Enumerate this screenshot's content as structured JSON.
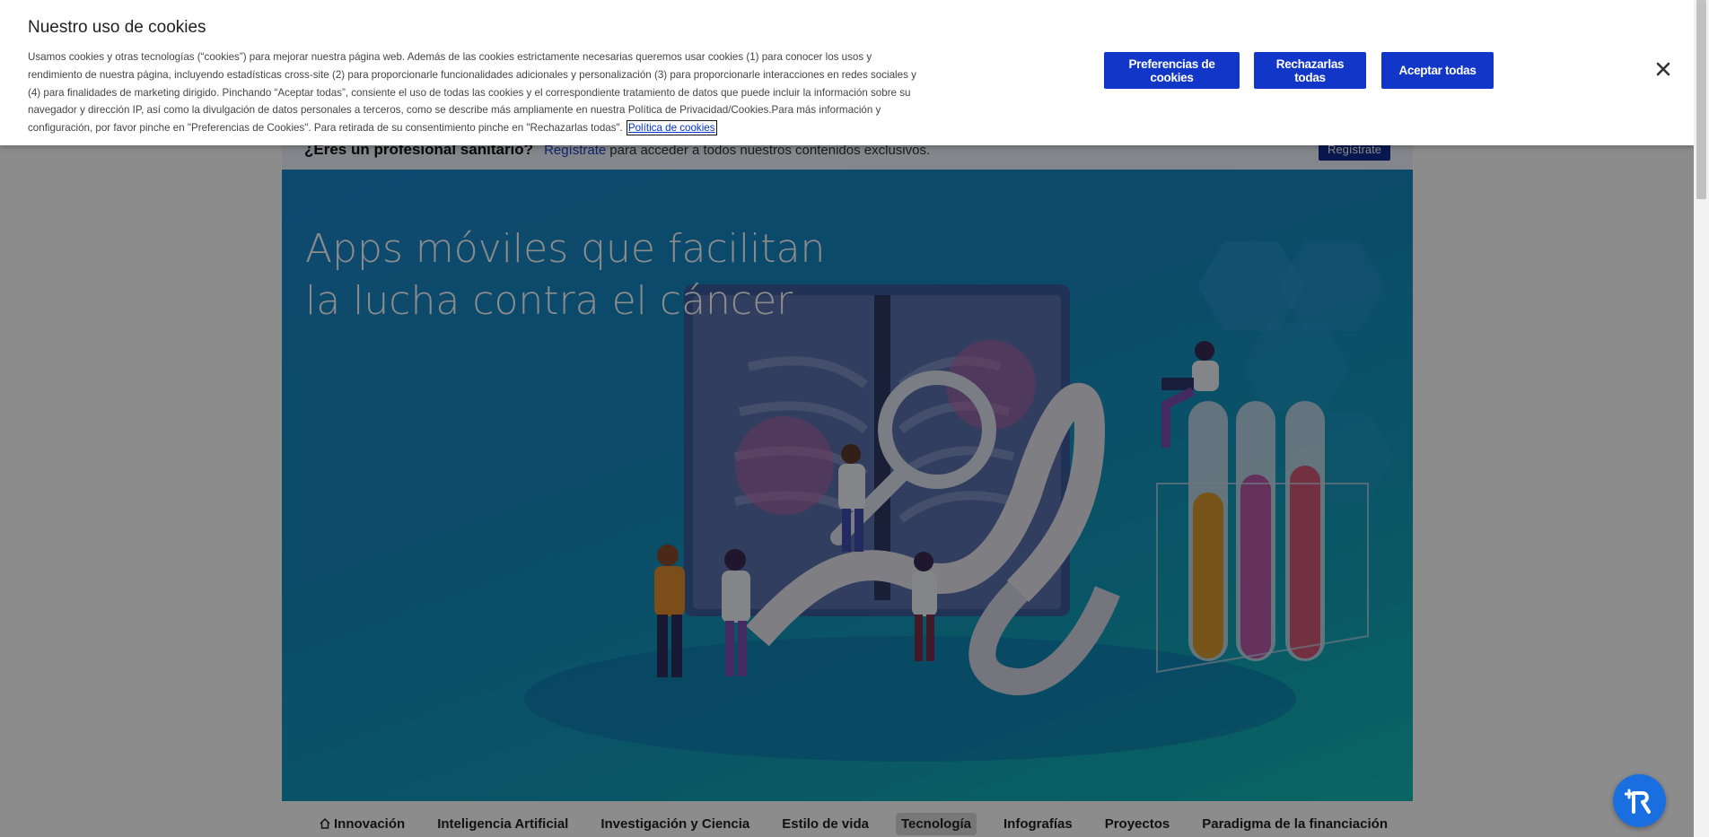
{
  "cookie_banner": {
    "title": "Nuestro uso de cookies",
    "text": "Usamos cookies y otras tecnologías (“cookies”) para mejorar nuestra página web. Además de las cookies estrictamente necesarias queremos usar cookies (1) para conocer los usos y rendimiento de nuestra página, incluyendo estadísticas cross-site (2) para proporcionarle funcionalidades adicionales y personalización (3) para proporcionarle interacciones en redes sociales y (4) para finalidades de marketing dirigido. Pinchando “Aceptar todas”, consiente el uso de todas las cookies y el correspondiente tratamiento de datos que puede incluir la información sobre su navegador y dirección IP, así como la divulgación de datos personales a terceros, como se describe más ampliamente en nuestra Política de Privacidad/Cookies.Para más información y configuración, por favor pinche en \"Preferencias de Cookies\". Para retirada de su consentimiento pinche en \"Rechazarlas todas\".",
    "policy_link": "Política de cookies",
    "buttons": {
      "preferences": "Preferencias de cookies",
      "reject": "Rechazarlas todas",
      "accept": "Aceptar todas"
    },
    "close_icon": "close-icon"
  },
  "pro_banner": {
    "question": "¿Eres un profesional sanitario?",
    "link": "Regístrate",
    "text": "para acceder a todos nuestros contenidos exclusivos.",
    "button": "Regístrate"
  },
  "hero": {
    "title": "Apps móviles que facilitan la lucha contra el cáncer"
  },
  "nav": {
    "items": [
      {
        "label": "Innovación",
        "icon": "home-icon"
      },
      {
        "label": "Inteligencia Artificial"
      },
      {
        "label": "Investigación y Ciencia"
      },
      {
        "label": "Estilo de vida"
      },
      {
        "label": "Tecnología",
        "active": true
      },
      {
        "label": "Infografías"
      },
      {
        "label": "Proyectos"
      },
      {
        "label": "Paradigma de la financiación"
      }
    ]
  },
  "colors": {
    "accent": "#1237c8",
    "overlay": "rgba(0,0,0,0.45)",
    "hero_start": "#1a86c9",
    "hero_end": "#12b9b4"
  }
}
